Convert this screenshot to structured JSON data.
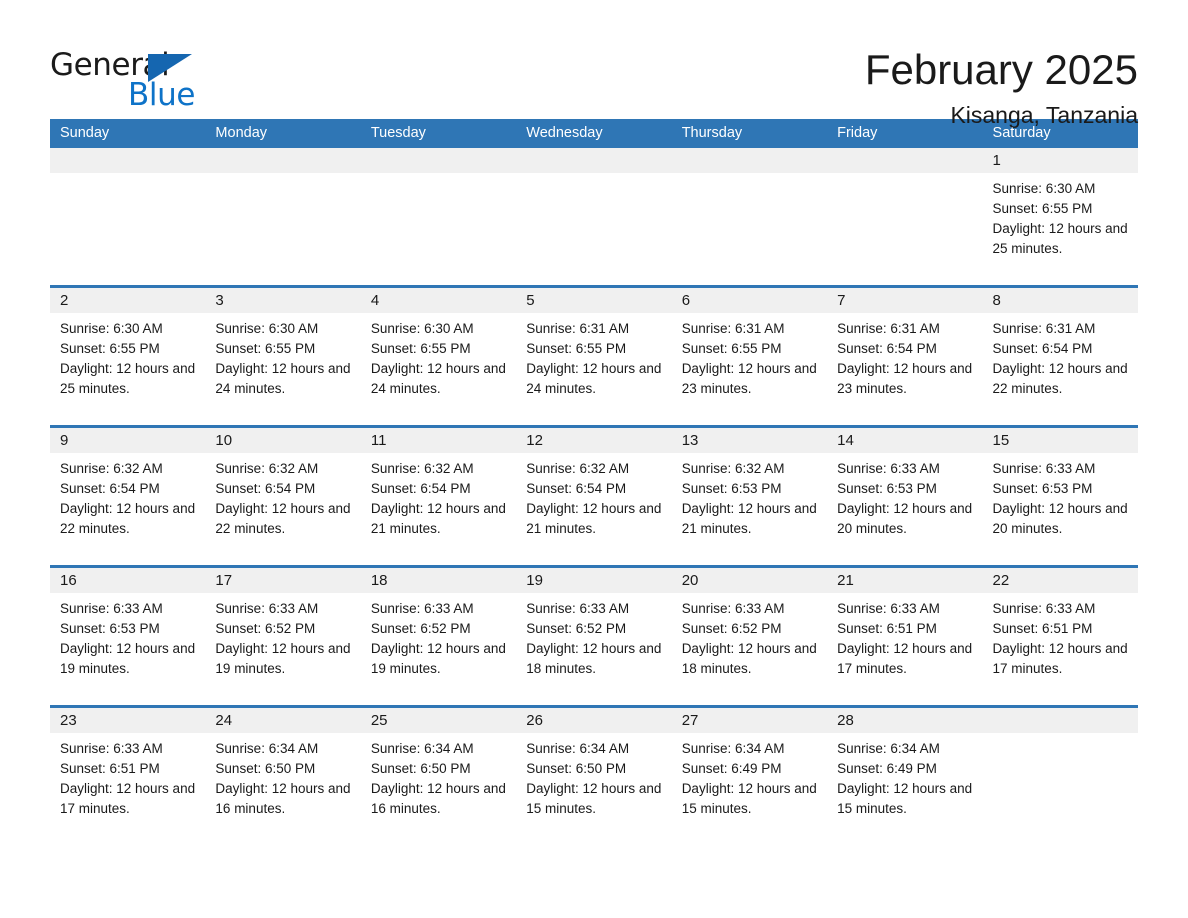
{
  "brand": {
    "name_part1": "General",
    "name_part2": "Blue",
    "triangle_color": "#1566b0",
    "blue_color": "#0e73c8"
  },
  "header": {
    "title": "February 2025",
    "subtitle": "Kisanga, Tanzania"
  },
  "theme": {
    "header_blue": "#2f76b5",
    "date_band_gray": "#f0f0f0",
    "text_color": "#1a1a1a"
  },
  "weekdays": [
    "Sunday",
    "Monday",
    "Tuesday",
    "Wednesday",
    "Thursday",
    "Friday",
    "Saturday"
  ],
  "weeks": [
    [
      {
        "day": "",
        "empty": true
      },
      {
        "day": "",
        "empty": true
      },
      {
        "day": "",
        "empty": true
      },
      {
        "day": "",
        "empty": true
      },
      {
        "day": "",
        "empty": true
      },
      {
        "day": "",
        "empty": true
      },
      {
        "day": "1",
        "sunrise": "Sunrise: 6:30 AM",
        "sunset": "Sunset: 6:55 PM",
        "daylight": "Daylight: 12 hours and 25 minutes."
      }
    ],
    [
      {
        "day": "2",
        "sunrise": "Sunrise: 6:30 AM",
        "sunset": "Sunset: 6:55 PM",
        "daylight": "Daylight: 12 hours and 25 minutes."
      },
      {
        "day": "3",
        "sunrise": "Sunrise: 6:30 AM",
        "sunset": "Sunset: 6:55 PM",
        "daylight": "Daylight: 12 hours and 24 minutes."
      },
      {
        "day": "4",
        "sunrise": "Sunrise: 6:30 AM",
        "sunset": "Sunset: 6:55 PM",
        "daylight": "Daylight: 12 hours and 24 minutes."
      },
      {
        "day": "5",
        "sunrise": "Sunrise: 6:31 AM",
        "sunset": "Sunset: 6:55 PM",
        "daylight": "Daylight: 12 hours and 24 minutes."
      },
      {
        "day": "6",
        "sunrise": "Sunrise: 6:31 AM",
        "sunset": "Sunset: 6:55 PM",
        "daylight": "Daylight: 12 hours and 23 minutes."
      },
      {
        "day": "7",
        "sunrise": "Sunrise: 6:31 AM",
        "sunset": "Sunset: 6:54 PM",
        "daylight": "Daylight: 12 hours and 23 minutes."
      },
      {
        "day": "8",
        "sunrise": "Sunrise: 6:31 AM",
        "sunset": "Sunset: 6:54 PM",
        "daylight": "Daylight: 12 hours and 22 minutes."
      }
    ],
    [
      {
        "day": "9",
        "sunrise": "Sunrise: 6:32 AM",
        "sunset": "Sunset: 6:54 PM",
        "daylight": "Daylight: 12 hours and 22 minutes."
      },
      {
        "day": "10",
        "sunrise": "Sunrise: 6:32 AM",
        "sunset": "Sunset: 6:54 PM",
        "daylight": "Daylight: 12 hours and 22 minutes."
      },
      {
        "day": "11",
        "sunrise": "Sunrise: 6:32 AM",
        "sunset": "Sunset: 6:54 PM",
        "daylight": "Daylight: 12 hours and 21 minutes."
      },
      {
        "day": "12",
        "sunrise": "Sunrise: 6:32 AM",
        "sunset": "Sunset: 6:54 PM",
        "daylight": "Daylight: 12 hours and 21 minutes."
      },
      {
        "day": "13",
        "sunrise": "Sunrise: 6:32 AM",
        "sunset": "Sunset: 6:53 PM",
        "daylight": "Daylight: 12 hours and 21 minutes."
      },
      {
        "day": "14",
        "sunrise": "Sunrise: 6:33 AM",
        "sunset": "Sunset: 6:53 PM",
        "daylight": "Daylight: 12 hours and 20 minutes."
      },
      {
        "day": "15",
        "sunrise": "Sunrise: 6:33 AM",
        "sunset": "Sunset: 6:53 PM",
        "daylight": "Daylight: 12 hours and 20 minutes."
      }
    ],
    [
      {
        "day": "16",
        "sunrise": "Sunrise: 6:33 AM",
        "sunset": "Sunset: 6:53 PM",
        "daylight": "Daylight: 12 hours and 19 minutes."
      },
      {
        "day": "17",
        "sunrise": "Sunrise: 6:33 AM",
        "sunset": "Sunset: 6:52 PM",
        "daylight": "Daylight: 12 hours and 19 minutes."
      },
      {
        "day": "18",
        "sunrise": "Sunrise: 6:33 AM",
        "sunset": "Sunset: 6:52 PM",
        "daylight": "Daylight: 12 hours and 19 minutes."
      },
      {
        "day": "19",
        "sunrise": "Sunrise: 6:33 AM",
        "sunset": "Sunset: 6:52 PM",
        "daylight": "Daylight: 12 hours and 18 minutes."
      },
      {
        "day": "20",
        "sunrise": "Sunrise: 6:33 AM",
        "sunset": "Sunset: 6:52 PM",
        "daylight": "Daylight: 12 hours and 18 minutes."
      },
      {
        "day": "21",
        "sunrise": "Sunrise: 6:33 AM",
        "sunset": "Sunset: 6:51 PM",
        "daylight": "Daylight: 12 hours and 17 minutes."
      },
      {
        "day": "22",
        "sunrise": "Sunrise: 6:33 AM",
        "sunset": "Sunset: 6:51 PM",
        "daylight": "Daylight: 12 hours and 17 minutes."
      }
    ],
    [
      {
        "day": "23",
        "sunrise": "Sunrise: 6:33 AM",
        "sunset": "Sunset: 6:51 PM",
        "daylight": "Daylight: 12 hours and 17 minutes."
      },
      {
        "day": "24",
        "sunrise": "Sunrise: 6:34 AM",
        "sunset": "Sunset: 6:50 PM",
        "daylight": "Daylight: 12 hours and 16 minutes."
      },
      {
        "day": "25",
        "sunrise": "Sunrise: 6:34 AM",
        "sunset": "Sunset: 6:50 PM",
        "daylight": "Daylight: 12 hours and 16 minutes."
      },
      {
        "day": "26",
        "sunrise": "Sunrise: 6:34 AM",
        "sunset": "Sunset: 6:50 PM",
        "daylight": "Daylight: 12 hours and 15 minutes."
      },
      {
        "day": "27",
        "sunrise": "Sunrise: 6:34 AM",
        "sunset": "Sunset: 6:49 PM",
        "daylight": "Daylight: 12 hours and 15 minutes."
      },
      {
        "day": "28",
        "sunrise": "Sunrise: 6:34 AM",
        "sunset": "Sunset: 6:49 PM",
        "daylight": "Daylight: 12 hours and 15 minutes."
      },
      {
        "day": "",
        "empty": true
      }
    ]
  ]
}
